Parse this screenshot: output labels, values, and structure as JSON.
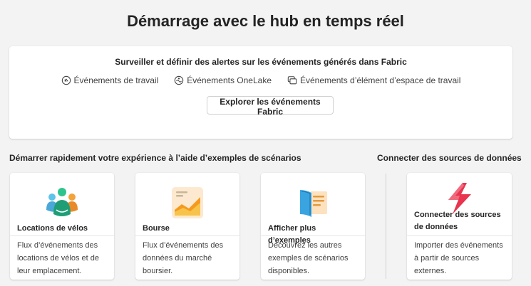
{
  "page": {
    "title": "Démarrage avec le hub en temps réel"
  },
  "events": {
    "heading": "Surveiller et définir des alertes sur les événements générés dans Fabric",
    "items": [
      {
        "label": "Événements de travail",
        "icon": "job-events-icon"
      },
      {
        "label": "Événements OneLake",
        "icon": "onelake-icon"
      },
      {
        "label": "Événements d’élément d’espace de travail",
        "icon": "workspace-item-icon"
      }
    ],
    "explore_label": "Explorer les événements Fabric"
  },
  "scenarios": {
    "heading": "Démarrer rapidement votre expérience à l’aide d’exemples de scénarios",
    "cards": [
      {
        "title": "Locations de vélos",
        "description": "Flux d’événements des locations de vélos et de leur emplacement.",
        "icon": "bike-people-icon"
      },
      {
        "title": "Bourse",
        "description": "Flux d’événements des données du marché boursier.",
        "icon": "stock-chart-icon"
      },
      {
        "title": "Afficher plus d’exemples",
        "description": "Découvrez les autres exemples de scénarios disponibles.",
        "icon": "book-icon"
      }
    ]
  },
  "connect": {
    "heading": "Connecter des sources de données",
    "card": {
      "title": "Connecter des sources de données",
      "description": "Importer des événements à partir de sources externes.",
      "icon": "lightning-icon"
    }
  },
  "colors": {
    "background": "#f3f3f3",
    "card": "#ffffff",
    "text": "#242424",
    "border": "#d1d1d1"
  }
}
